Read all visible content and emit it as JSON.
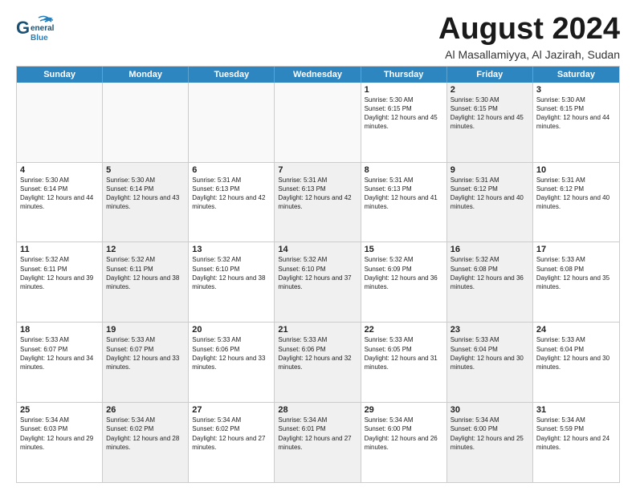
{
  "header": {
    "logo_general": "General",
    "logo_blue": "Blue",
    "month_title": "August 2024",
    "subtitle": "Al Masallamiyya, Al Jazirah, Sudan"
  },
  "weekdays": [
    "Sunday",
    "Monday",
    "Tuesday",
    "Wednesday",
    "Thursday",
    "Friday",
    "Saturday"
  ],
  "weeks": [
    [
      {
        "day": "",
        "empty": true,
        "shade": false
      },
      {
        "day": "",
        "empty": true,
        "shade": false
      },
      {
        "day": "",
        "empty": true,
        "shade": false
      },
      {
        "day": "",
        "empty": true,
        "shade": false
      },
      {
        "day": "1",
        "empty": false,
        "shade": false,
        "sunrise": "5:30 AM",
        "sunset": "6:15 PM",
        "daylight": "12 hours and 45 minutes."
      },
      {
        "day": "2",
        "empty": false,
        "shade": true,
        "sunrise": "5:30 AM",
        "sunset": "6:15 PM",
        "daylight": "12 hours and 45 minutes."
      },
      {
        "day": "3",
        "empty": false,
        "shade": false,
        "sunrise": "5:30 AM",
        "sunset": "6:15 PM",
        "daylight": "12 hours and 44 minutes."
      }
    ],
    [
      {
        "day": "4",
        "empty": false,
        "shade": false,
        "sunrise": "5:30 AM",
        "sunset": "6:14 PM",
        "daylight": "12 hours and 44 minutes."
      },
      {
        "day": "5",
        "empty": false,
        "shade": true,
        "sunrise": "5:30 AM",
        "sunset": "6:14 PM",
        "daylight": "12 hours and 43 minutes."
      },
      {
        "day": "6",
        "empty": false,
        "shade": false,
        "sunrise": "5:31 AM",
        "sunset": "6:13 PM",
        "daylight": "12 hours and 42 minutes."
      },
      {
        "day": "7",
        "empty": false,
        "shade": true,
        "sunrise": "5:31 AM",
        "sunset": "6:13 PM",
        "daylight": "12 hours and 42 minutes."
      },
      {
        "day": "8",
        "empty": false,
        "shade": false,
        "sunrise": "5:31 AM",
        "sunset": "6:13 PM",
        "daylight": "12 hours and 41 minutes."
      },
      {
        "day": "9",
        "empty": false,
        "shade": true,
        "sunrise": "5:31 AM",
        "sunset": "6:12 PM",
        "daylight": "12 hours and 40 minutes."
      },
      {
        "day": "10",
        "empty": false,
        "shade": false,
        "sunrise": "5:31 AM",
        "sunset": "6:12 PM",
        "daylight": "12 hours and 40 minutes."
      }
    ],
    [
      {
        "day": "11",
        "empty": false,
        "shade": false,
        "sunrise": "5:32 AM",
        "sunset": "6:11 PM",
        "daylight": "12 hours and 39 minutes."
      },
      {
        "day": "12",
        "empty": false,
        "shade": true,
        "sunrise": "5:32 AM",
        "sunset": "6:11 PM",
        "daylight": "12 hours and 38 minutes."
      },
      {
        "day": "13",
        "empty": false,
        "shade": false,
        "sunrise": "5:32 AM",
        "sunset": "6:10 PM",
        "daylight": "12 hours and 38 minutes."
      },
      {
        "day": "14",
        "empty": false,
        "shade": true,
        "sunrise": "5:32 AM",
        "sunset": "6:10 PM",
        "daylight": "12 hours and 37 minutes."
      },
      {
        "day": "15",
        "empty": false,
        "shade": false,
        "sunrise": "5:32 AM",
        "sunset": "6:09 PM",
        "daylight": "12 hours and 36 minutes."
      },
      {
        "day": "16",
        "empty": false,
        "shade": true,
        "sunrise": "5:32 AM",
        "sunset": "6:08 PM",
        "daylight": "12 hours and 36 minutes."
      },
      {
        "day": "17",
        "empty": false,
        "shade": false,
        "sunrise": "5:33 AM",
        "sunset": "6:08 PM",
        "daylight": "12 hours and 35 minutes."
      }
    ],
    [
      {
        "day": "18",
        "empty": false,
        "shade": false,
        "sunrise": "5:33 AM",
        "sunset": "6:07 PM",
        "daylight": "12 hours and 34 minutes."
      },
      {
        "day": "19",
        "empty": false,
        "shade": true,
        "sunrise": "5:33 AM",
        "sunset": "6:07 PM",
        "daylight": "12 hours and 33 minutes."
      },
      {
        "day": "20",
        "empty": false,
        "shade": false,
        "sunrise": "5:33 AM",
        "sunset": "6:06 PM",
        "daylight": "12 hours and 33 minutes."
      },
      {
        "day": "21",
        "empty": false,
        "shade": true,
        "sunrise": "5:33 AM",
        "sunset": "6:06 PM",
        "daylight": "12 hours and 32 minutes."
      },
      {
        "day": "22",
        "empty": false,
        "shade": false,
        "sunrise": "5:33 AM",
        "sunset": "6:05 PM",
        "daylight": "12 hours and 31 minutes."
      },
      {
        "day": "23",
        "empty": false,
        "shade": true,
        "sunrise": "5:33 AM",
        "sunset": "6:04 PM",
        "daylight": "12 hours and 30 minutes."
      },
      {
        "day": "24",
        "empty": false,
        "shade": false,
        "sunrise": "5:33 AM",
        "sunset": "6:04 PM",
        "daylight": "12 hours and 30 minutes."
      }
    ],
    [
      {
        "day": "25",
        "empty": false,
        "shade": false,
        "sunrise": "5:34 AM",
        "sunset": "6:03 PM",
        "daylight": "12 hours and 29 minutes."
      },
      {
        "day": "26",
        "empty": false,
        "shade": true,
        "sunrise": "5:34 AM",
        "sunset": "6:02 PM",
        "daylight": "12 hours and 28 minutes."
      },
      {
        "day": "27",
        "empty": false,
        "shade": false,
        "sunrise": "5:34 AM",
        "sunset": "6:02 PM",
        "daylight": "12 hours and 27 minutes."
      },
      {
        "day": "28",
        "empty": false,
        "shade": true,
        "sunrise": "5:34 AM",
        "sunset": "6:01 PM",
        "daylight": "12 hours and 27 minutes."
      },
      {
        "day": "29",
        "empty": false,
        "shade": false,
        "sunrise": "5:34 AM",
        "sunset": "6:00 PM",
        "daylight": "12 hours and 26 minutes."
      },
      {
        "day": "30",
        "empty": false,
        "shade": true,
        "sunrise": "5:34 AM",
        "sunset": "6:00 PM",
        "daylight": "12 hours and 25 minutes."
      },
      {
        "day": "31",
        "empty": false,
        "shade": false,
        "sunrise": "5:34 AM",
        "sunset": "5:59 PM",
        "daylight": "12 hours and 24 minutes."
      }
    ]
  ]
}
